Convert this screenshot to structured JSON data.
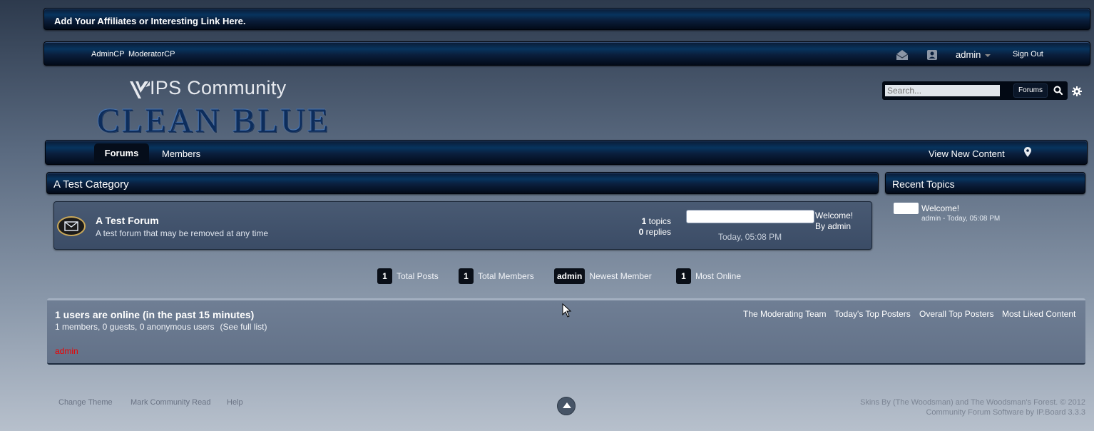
{
  "affiliate_text": "Add Your Affiliates or Interesting Link Here.",
  "userbar": {
    "admincp": "AdminCP",
    "modcp": "ModeratorCP",
    "username": "admin",
    "sign_out": "Sign Out",
    "messages_icon": "envelope-icon",
    "notifications_icon": "badge-icon"
  },
  "logo": {
    "line1": "IPS Community",
    "line2": "CLEAN BLUE"
  },
  "search": {
    "placeholder": "Search...",
    "scope": "Forums"
  },
  "nav": {
    "forums": "Forums",
    "members": "Members",
    "view_new": "View New Content"
  },
  "category": {
    "title": "A Test Category"
  },
  "forum": {
    "title": "A Test Forum",
    "description": "A test forum that may be removed at any time",
    "topics_count": "1",
    "topics_label": "topics",
    "replies_count": "0",
    "replies_label": "replies",
    "last_post_title": "Welcome!",
    "last_post_by": "By admin",
    "last_post_date": "Today, 05:08 PM"
  },
  "recent_topics": {
    "header": "Recent Topics",
    "title": "Welcome!",
    "meta": "admin - Today, 05:08 PM"
  },
  "stats": [
    {
      "value": "1",
      "label": "Total Posts"
    },
    {
      "value": "1",
      "label": "Total Members"
    },
    {
      "value": "admin",
      "label": "Newest Member"
    },
    {
      "value": "1",
      "label": "Most Online"
    }
  ],
  "online": {
    "title": "1 users are online (in the past 15 minutes)",
    "subtitle": "1 members, 0 guests, 0 anonymous users",
    "full_list": "(See full list)",
    "user": "admin",
    "links": [
      "The Moderating Team",
      "Today's Top Posters",
      "Overall Top Posters",
      "Most Liked Content"
    ]
  },
  "footer": {
    "change_theme": "Change Theme",
    "mark_read": "Mark Community Read",
    "help": "Help",
    "credit1": "Skins By (The Woodsman) and The Woodsman's Forest. © 2012",
    "credit2": "Community Forum Software by IP.Board 3.3.3"
  },
  "colors": {
    "online_user": "#ee0000",
    "bar_blue": "#07345e"
  }
}
